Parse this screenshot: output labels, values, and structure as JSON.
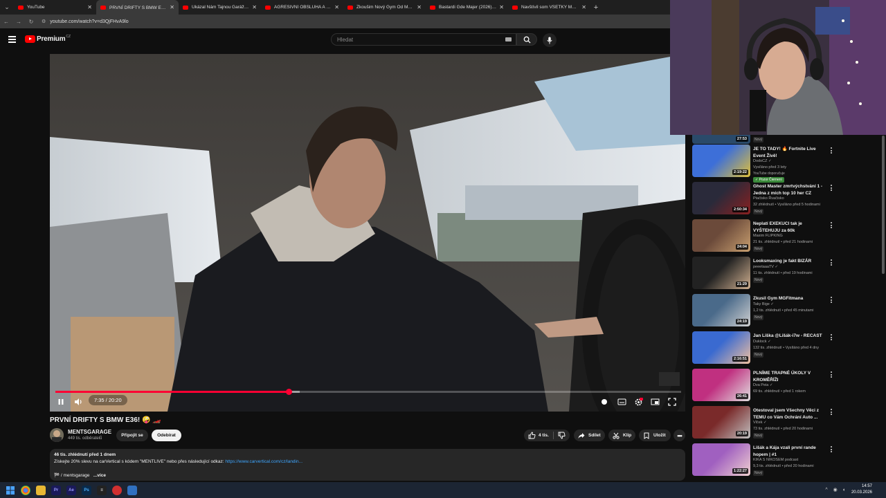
{
  "browser": {
    "tabs": [
      {
        "title": "YouTube",
        "active": false
      },
      {
        "title": "PRVNÍ DRIFTY S BMW E36! 🤪",
        "active": true
      },
      {
        "title": "Ukázal Nám Tajnou Garáž S Au",
        "active": false
      },
      {
        "title": "AGRESIVNÍ OBSLUHA A STRAŠ",
        "active": false
      },
      {
        "title": "Zkoušim Nový Gym Od MG Fit",
        "active": false
      },
      {
        "title": "Bastardi Gde Majer (2026) HD",
        "active": false
      },
      {
        "title": "Navštívil som VŠETKY MOJE ŠK",
        "active": false
      }
    ],
    "url": "youtube.com/watch?v=d3QjFHvA9lo"
  },
  "header": {
    "logo_text": "Premium",
    "country": "CZ",
    "search_placeholder": "Hledat"
  },
  "player": {
    "time": "7:35 / 20:20",
    "progress": 0.373,
    "buffered": 0.39
  },
  "video": {
    "title": "PRVNÍ DRIFTY S BMW E36! 🤪 🏎️",
    "channel": "MENTSGARAGE",
    "subscribers": "449 tis. odběratelů",
    "join_label": "Připojit se",
    "subscribe_label": "Odebírat",
    "likes": "4 tis.",
    "share_label": "Sdílet",
    "clip_label": "Klip",
    "save_label": "Uložit",
    "description_stats": "46 tis. zhlédnutí  před 1 dnem",
    "description_text": "Získejte 20% slevu na carVertical s kódem \"MENTLIVE\" nebo přes následující odkaz: ",
    "description_link": "https://www.carvertical.com/cz/landin...",
    "hashtag": "🏁 / mentsgarage",
    "more_label": "...více"
  },
  "sidebar": {
    "top_badge": "Nový",
    "top_duration": "27:53",
    "items": [
      {
        "title": "JE TO TADY! 🔥 Fortnite Live Event Živě!",
        "channel": "DodoCZ ✓",
        "stats": "Vysíláno před 3 lety",
        "extra": "YouTube doporučuje",
        "green": "✓ Pozor Čiernení",
        "duration": "2:19:22",
        "color1": "#3d6fd8",
        "color2": "#e0c03a"
      },
      {
        "title": "Ghost Master zmrtvýchstvání 1 - Jedna z mích top 10 her CZ",
        "channel": "Ptačisko Řvačisko",
        "stats": "32 zhlédnutí • Vysíláno před 5 hodinami",
        "badge": "Nový",
        "duration": "2:50:34",
        "color1": "#2a2a3a",
        "color2": "#8a2020"
      },
      {
        "title": "Neplatí EXEKUCI tak je VYŠTEHUJU za 60k",
        "channel": "Maxim FLIPKING",
        "stats": "21 tis. zhlédnutí • před 21 hodinami",
        "badge": "Nový",
        "duration": "24:04",
        "color1": "#6b4a3a",
        "color2": "#c9a070"
      },
      {
        "title": "Looksmaxing je fakt BIZÁR",
        "channel": "peeetaaaTV ✓",
        "stats": "11 tis. zhlédnutí • před 19 hodinami",
        "badge": "Nový",
        "duration": "21:29",
        "color1": "#222",
        "color2": "#d0b090"
      },
      {
        "title": "Zkusil Gym MGFitmana",
        "channel": "Taky Bige ✓",
        "stats": "1,2 tis. zhlédnutí • před 45 minutami",
        "badge": "Nový",
        "duration": "24:19",
        "color1": "#4a6a8a",
        "color2": "#d0d0d0"
      },
      {
        "title": "Jan Liška @Lišák-i7w - RECAST",
        "channel": "Duklock ✓",
        "stats": "132 tis. zhlédnutí • Vysíláno před 4 dny",
        "badge": "Nový",
        "duration": "2:16:51",
        "color1": "#3a6ad0",
        "color2": "#f0c0a0"
      },
      {
        "title": "PLNÍME TRAPNÉ ÚKOLY V KROMĚŘÍŽI",
        "channel": "Dva Peia ✓",
        "stats": "69 tis. zhlédnutí • před 1 rokem",
        "duration": "26:41",
        "color1": "#c03080",
        "color2": "#e0e0e0"
      },
      {
        "title": "Otestoval jsem Všechny Věci z TEMU co Vám Ochrání Auto ...",
        "channel": "Vlček ✓",
        "stats": "73 tis. zhlédnutí • před 20 hodinami",
        "badge": "Nový",
        "duration": "20:19",
        "color1": "#7a2a2a",
        "color2": "#c0c0c0"
      },
      {
        "title": "Lišák a Kája vzali první rande hopem | #1",
        "channel": "KIKA S NIKOSEM podcast",
        "stats": "9,3 tis. zhlédnutí • před 20 hodinami",
        "badge": "Nový",
        "duration": "1:22:27",
        "color1": "#a060c0",
        "color2": "#f0d0d0"
      }
    ]
  },
  "taskbar": {
    "time": "14:57",
    "date": "20.03.2026"
  }
}
